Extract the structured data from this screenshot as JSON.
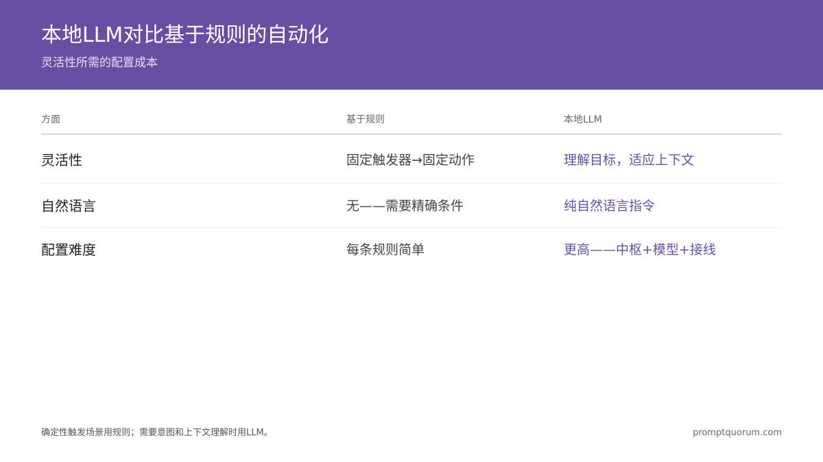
{
  "header": {
    "title": "本地LLM对比基于规则的自动化",
    "subtitle": "灵活性所需的配置成本",
    "background_color": "#6750a4"
  },
  "table": {
    "columns": [
      "方面",
      "基于规则",
      "本地LLM"
    ],
    "rows": [
      [
        "灵活性",
        "固定触发器→固定动作",
        "理解目标，适应上下文"
      ],
      [
        "自然语言",
        "无——需要精确条件",
        "纯自然语言指令"
      ],
      [
        "配置难度",
        "每条规则简单",
        "更高——中枢+模型+接线"
      ]
    ],
    "accent_color": "#6750a4"
  },
  "footer": {
    "note": "确定性触发场景用规则；需要意图和上下文理解时用LLM。",
    "site": "promptquorum.com"
  }
}
